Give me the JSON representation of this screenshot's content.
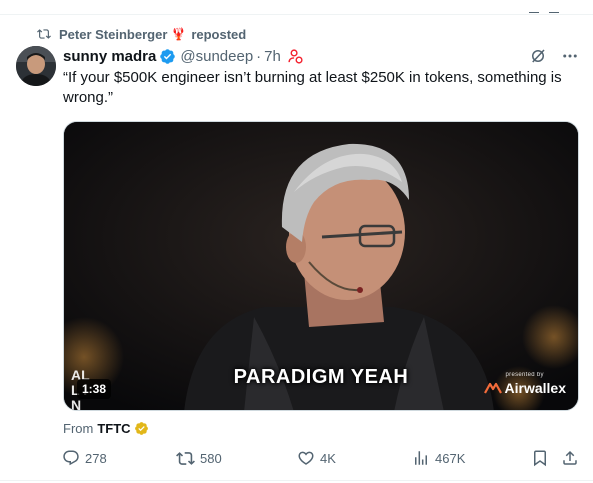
{
  "repost": {
    "reposter": "Peter Steinberger",
    "reposter_badge": "lobster-emoji",
    "label": "reposted"
  },
  "tweet": {
    "author_name": "sunny madra",
    "author_verified": true,
    "handle": "@sundeep",
    "separator": "·",
    "time": "7h",
    "text": "“If your $500K engineer isn’t burning at least $250K in tokens, something is wrong.”",
    "media": {
      "caption": "PARADIGM YEAH",
      "duration": "1:38",
      "channel_logo": "ALL IN",
      "sponsor_label": "presented by",
      "sponsor_name": "Airwallex"
    },
    "from_label": "From",
    "from_source": "TFTC"
  },
  "actions": {
    "replies": "278",
    "reposts": "580",
    "likes": "4K",
    "views": "467K"
  },
  "colors": {
    "text_primary": "#0f1419",
    "text_secondary": "#536471",
    "verified_blue": "#1d9bf0",
    "gold_badge": "#e2b719",
    "subscribe_red": "#f4212e",
    "divider": "#eff3f4"
  },
  "icons": [
    "repost-icon",
    "lobster-icon",
    "verified-badge-icon",
    "subscribe-icon",
    "grok-icon",
    "more-icon",
    "reply-icon",
    "like-icon",
    "views-icon",
    "bookmark-icon",
    "share-icon",
    "airwallex-logo-icon",
    "gold-badge-icon"
  ]
}
